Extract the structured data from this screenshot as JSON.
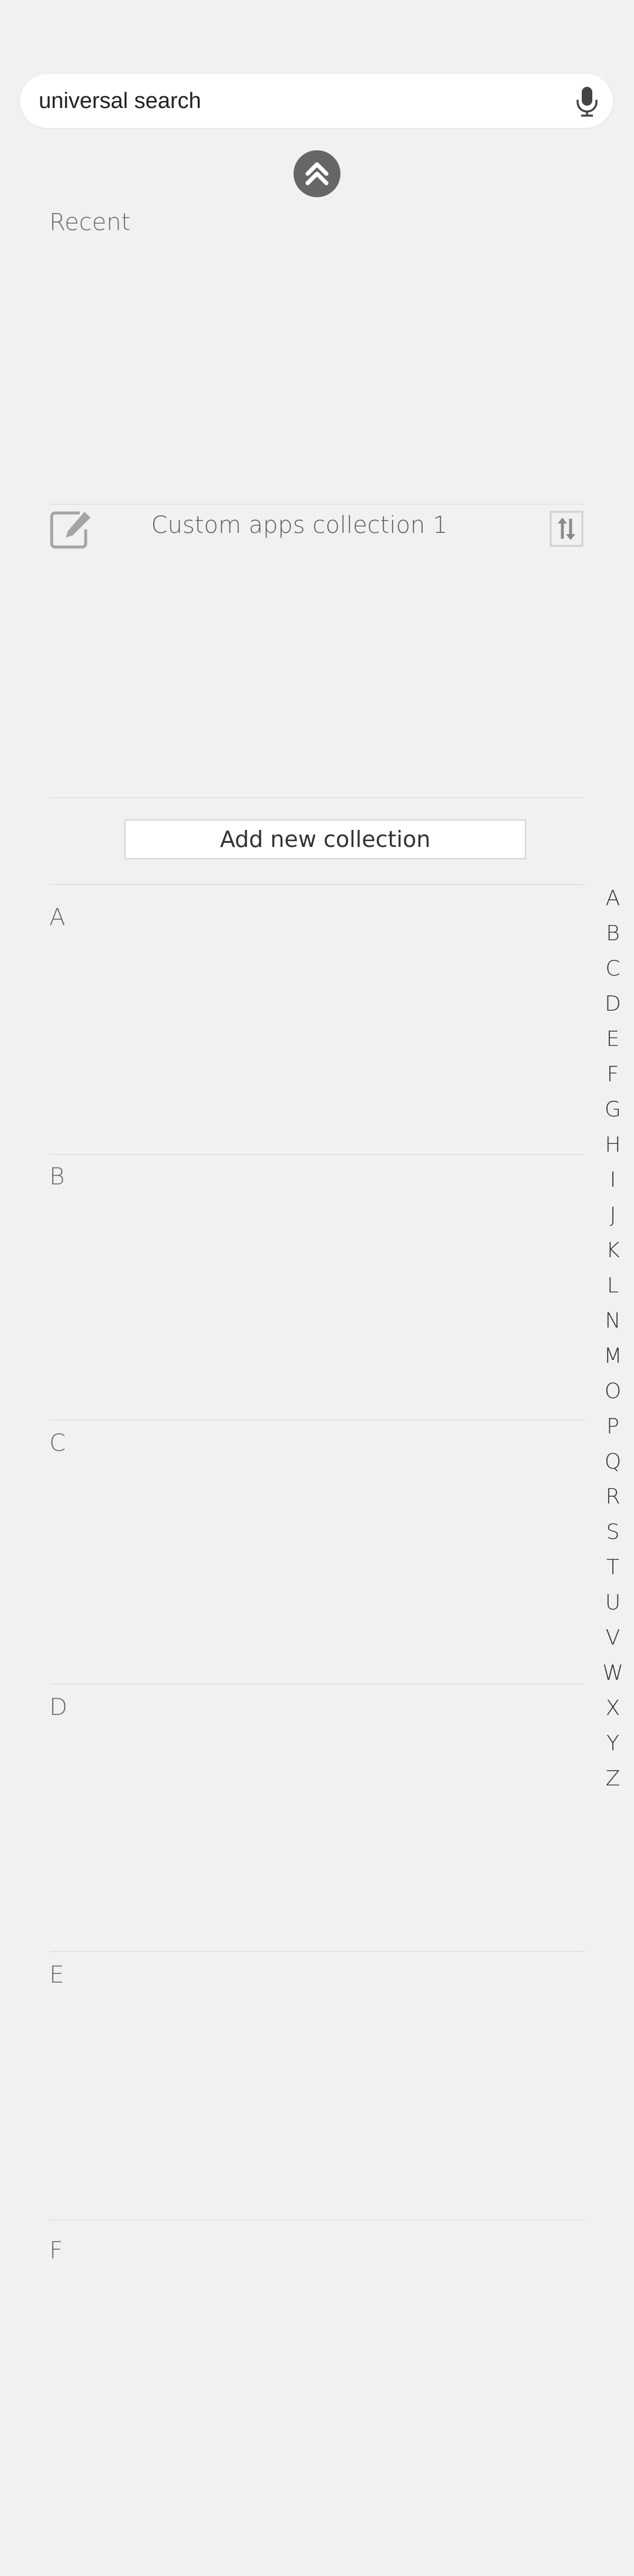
{
  "search": {
    "placeholder": "universal search"
  },
  "recent": {
    "title": "Recent"
  },
  "collection": {
    "name": "Custom apps collection 1"
  },
  "add_collection": {
    "label": "Add new collection"
  },
  "sections": [
    "A",
    "B",
    "C",
    "D",
    "E",
    "F"
  ],
  "alphabet": [
    "A",
    "B",
    "C",
    "D",
    "E",
    "F",
    "G",
    "H",
    "I",
    "J",
    "K",
    "L",
    "N",
    "M",
    "O",
    "P",
    "Q",
    "R",
    "S",
    "T",
    "U",
    "V",
    "W",
    "X",
    "Y",
    "Z"
  ],
  "colors": {
    "background": "#f1f1f1",
    "icon_gray": "#666666",
    "divider": "#e3e3e3"
  }
}
